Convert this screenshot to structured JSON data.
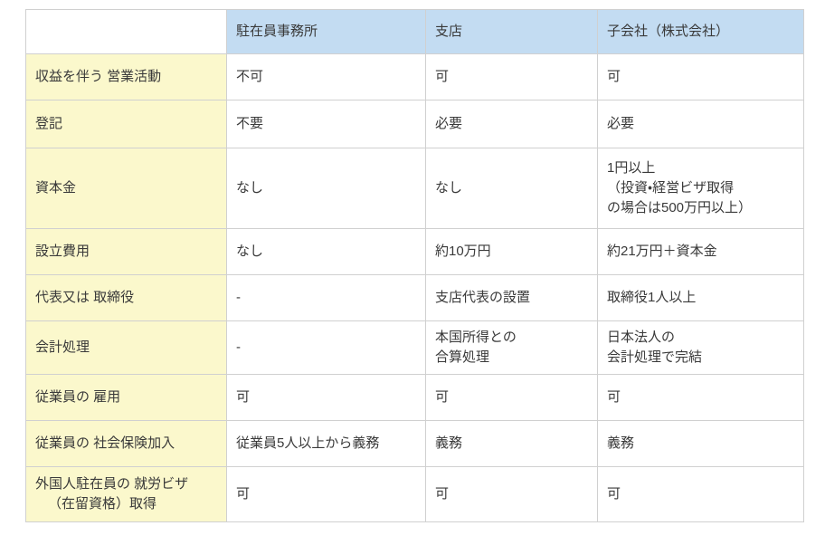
{
  "table": {
    "corner_label": "",
    "columns": [
      "駐在員事務所",
      "支店",
      "子会社（株式会社）"
    ],
    "rows": [
      {
        "label": "収益を伴う 営業活動",
        "label_lines": [
          "収益を伴う 営業活動"
        ],
        "rep_office": "不可",
        "branch": "可",
        "subsidiary": "可"
      },
      {
        "label": "登記",
        "label_lines": [
          "登記"
        ],
        "rep_office": "不要",
        "branch": "必要",
        "subsidiary": "必要"
      },
      {
        "label": "資本金",
        "label_lines": [
          "資本金"
        ],
        "rep_office": "なし",
        "branch": "なし",
        "subsidiary": "1円以上\n（投資・経営ビザ取得\nの場合は500万円以上）",
        "subsidiary_lines": [
          "1円以上",
          "（投資・経営ビザ取得",
          "の場合は500万円以上）"
        ]
      },
      {
        "label": "設立費用",
        "label_lines": [
          "設立費用"
        ],
        "rep_office": "なし",
        "branch": "約10万円",
        "subsidiary": "約21万円＋資本金"
      },
      {
        "label": "代表又は 取締役",
        "label_lines": [
          "代表又は 取締役"
        ],
        "rep_office": "-",
        "branch": "支店代表の設置",
        "subsidiary": "取締役1人以上"
      },
      {
        "label": "会計処理",
        "label_lines": [
          "会計処理"
        ],
        "rep_office": "-",
        "branch": "本国所得との\n合算処理",
        "branch_lines": [
          "本国所得との",
          "合算処理"
        ],
        "subsidiary": "日本法人の\n会計処理で完結",
        "subsidiary_lines": [
          "日本法人の",
          "会計処理で完結"
        ]
      },
      {
        "label": "従業員の 雇用",
        "label_lines": [
          "従業員の 雇用"
        ],
        "rep_office": "可",
        "branch": "可",
        "subsidiary": "可"
      },
      {
        "label": "従業員の 社会保険加入",
        "label_lines": [
          "従業員の 社会保険加入"
        ],
        "rep_office": "従業員5人以上から義務",
        "branch": "義務",
        "subsidiary": "義務"
      },
      {
        "label": "外国人駐在員の 就労ビザ（在留資格）取得",
        "label_lines": [
          "外国人駐在員の 就労ビザ",
          "（在留資格）取得"
        ],
        "rep_office": "可",
        "branch": "可",
        "subsidiary": "可"
      }
    ]
  },
  "colors": {
    "header_blue": "#c3dcf2",
    "label_yellow": "#fbf8cc",
    "border_gray": "#d0d0d0",
    "text": "#3a3a3a",
    "background": "#ffffff"
  }
}
